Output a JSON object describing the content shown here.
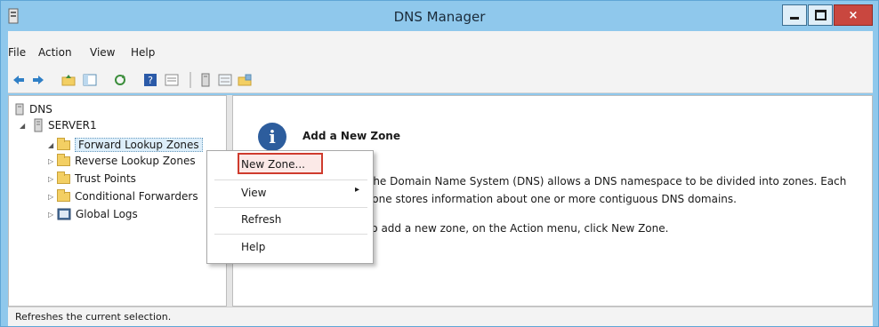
{
  "window": {
    "title": "DNS Manager",
    "close_glyph": "×"
  },
  "menu": [
    {
      "label": "File"
    },
    {
      "label": "Action"
    },
    {
      "label": "View"
    },
    {
      "label": "Help"
    }
  ],
  "tree": {
    "root": "DNS",
    "server": "SERVER1",
    "items": [
      {
        "label": "Forward Lookup Zones"
      },
      {
        "label": "Reverse Lookup Zones"
      },
      {
        "label": "Trust Points"
      },
      {
        "label": "Conditional Forwarders"
      },
      {
        "label": "Global Logs"
      }
    ]
  },
  "content": {
    "heading": "Add a New Zone",
    "description": "The Domain Name System (DNS) allows a DNS namespace to be divided into zones. Each zone stores information about one or more contiguous DNS domains.",
    "instruction": "To add a new zone, on the Action menu, click New Zone."
  },
  "context_menu": {
    "items": [
      "New Zone...",
      "View",
      "Refresh",
      "Help"
    ],
    "submenu_arrow": "▸"
  },
  "status": "Refreshes the current selection.",
  "colors": {
    "title_bar": "#8fc8ec",
    "close_button": "#c9473f",
    "highlight_border": "#cf3b2d"
  }
}
